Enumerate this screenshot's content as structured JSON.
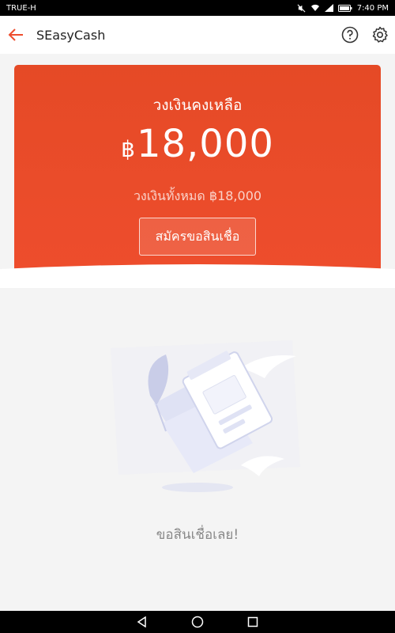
{
  "status_bar": {
    "carrier": "TRUE-H",
    "time": "7:40 PM",
    "icons": [
      "mute-icon",
      "wifi-icon",
      "signal-icon",
      "battery-icon"
    ]
  },
  "app_bar": {
    "title": "SEasyCash",
    "back_icon": "arrow-left-icon",
    "help_icon": "help-circle-icon",
    "settings_icon": "gear-icon",
    "accent_color": "#ee4d2d"
  },
  "credit_card": {
    "label": "วงเงินคงเหลือ",
    "currency_symbol": "฿",
    "amount": "18,000",
    "total_label": "วงเงินทั้งหมด ฿18,000",
    "apply_button": "สมัครขอสินเชื่อ",
    "color": "#ee4d2d"
  },
  "empty_state": {
    "illustration": "document-feather-illustration",
    "message": "ขอสินเชื่อเลย!"
  },
  "nav_bar": {
    "icons": [
      "back-triangle-icon",
      "home-circle-icon",
      "recents-square-icon"
    ]
  }
}
